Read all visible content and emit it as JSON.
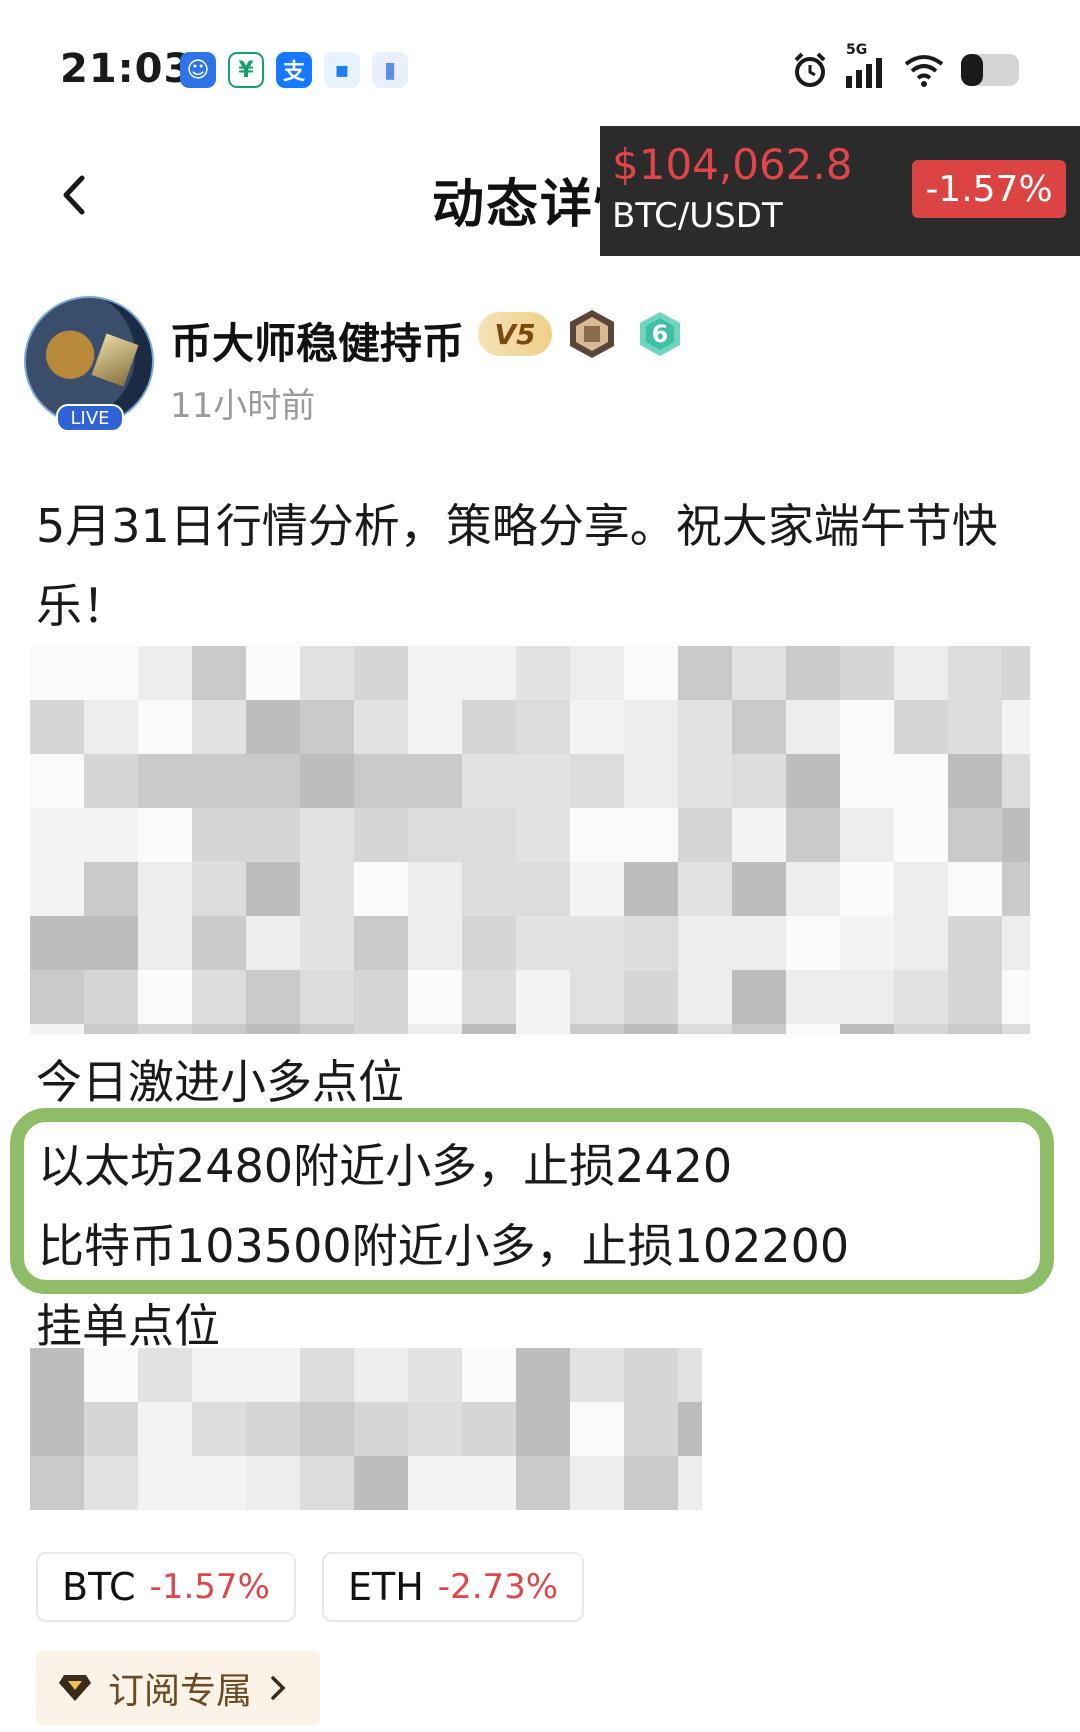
{
  "status_bar": {
    "time": "21:03",
    "network": "5G"
  },
  "header": {
    "title": "动态详情"
  },
  "ticker": {
    "price": "$104,062.8",
    "pair": "BTC/USDT",
    "change": "-1.57%"
  },
  "author": {
    "name": "币大师稳健持币",
    "level": "V5",
    "badge_number": "6",
    "live_label": "LIVE",
    "time_ago": "11小时前"
  },
  "post": {
    "intro": "5月31日行情分析，策略分享。祝大家端午节快乐！",
    "aggressive_heading": "今日激进小多点位",
    "eth_line": "以太坊2480附近小多，止损2420",
    "btc_line": "比特币103500附近小多，止损102200",
    "pending_heading": "挂单点位"
  },
  "tags": [
    {
      "symbol": "BTC",
      "change": "-1.57%"
    },
    {
      "symbol": "ETH",
      "change": "-2.73%"
    }
  ],
  "subscribe": {
    "label": "订阅专属"
  },
  "colors": {
    "negative": "#e0454a",
    "highlight_border": "#8fbc66",
    "ticker_bg": "#2b2b2b"
  }
}
